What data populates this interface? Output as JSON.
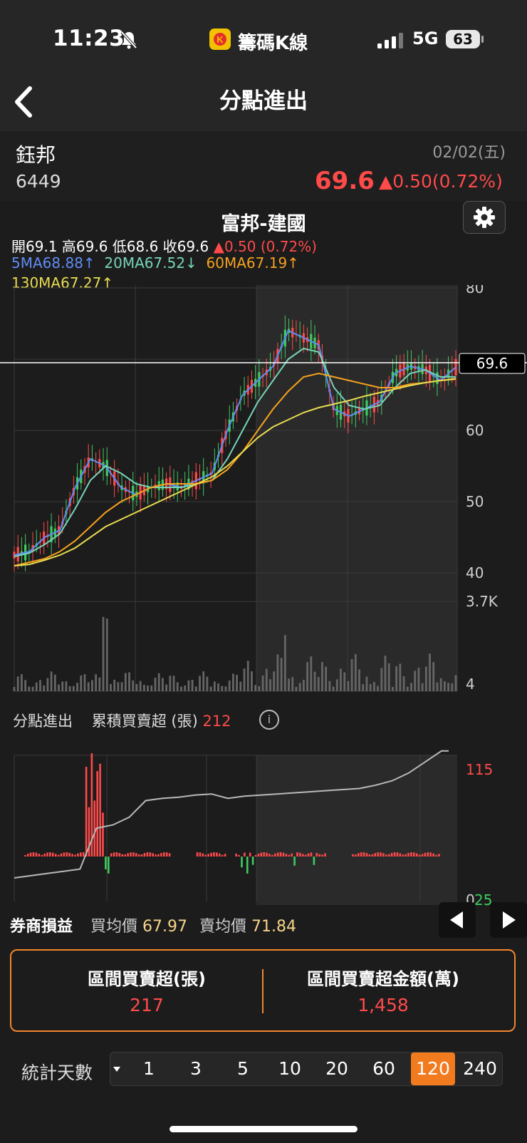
{
  "status": {
    "time": "11:23",
    "app_name": "籌碼K線",
    "network": "5G",
    "battery": "63"
  },
  "nav": {
    "title": "分點進出"
  },
  "stock": {
    "name": "鈺邦",
    "code": "6449",
    "date": "02/02(五)",
    "price": "69.6",
    "change": "▲0.50(0.72%)"
  },
  "broker": {
    "title": "富邦-建國"
  },
  "ohlc": {
    "open_label": "開",
    "open": "69.1",
    "high_label": "高",
    "high": "69.6",
    "low_label": "低",
    "low": "68.6",
    "close_label": "收",
    "close": "69.6",
    "change": "▲0.50 (0.72%)"
  },
  "ma": {
    "ma5": "5MA68.88↑",
    "ma20": "20MA67.52↓",
    "ma60": "60MA67.19↑",
    "ma130": "130MA67.27↑"
  },
  "price_axis": {
    "ticks": [
      "80",
      "60",
      "50",
      "40"
    ],
    "current": "69.6"
  },
  "volume_axis": {
    "max": "3.7K",
    "min": "4"
  },
  "flow": {
    "label": "分點進出",
    "cum_label": "累積買賣超 (張)",
    "cum_value": "212",
    "info": "i",
    "axis_max": "115",
    "axis_min_a": "0",
    "axis_min_b": "25"
  },
  "pnl": {
    "label": "券商損益",
    "buy_avg_label": "買均價",
    "buy_avg": "67.97",
    "sell_avg_label": "賣均價",
    "sell_avg": "71.84"
  },
  "summary": {
    "net_label": "區間買賣超(張)",
    "net_value": "217",
    "amount_label": "區間買賣超金額(萬)",
    "amount_value": "1,458"
  },
  "days": {
    "label": "統計天數",
    "options": [
      "1",
      "3",
      "5",
      "10",
      "20",
      "60",
      "120",
      "240"
    ],
    "selected": "120"
  },
  "colors": {
    "up": "#ff4a4a",
    "down": "#3ecb5f",
    "accent": "#f27b1f",
    "ma5": "#5f8cf5",
    "ma20": "#76d4b8",
    "ma60": "#f5a21e",
    "ma130": "#e8dc50"
  },
  "chart_data": [
    {
      "type": "line",
      "title": "富邦-建國",
      "ylim": [
        40,
        80
      ],
      "series": [
        {
          "name": "5MA",
          "values": [
            42.5,
            43,
            45,
            46,
            52,
            56,
            55,
            52,
            51,
            52,
            52.5,
            52,
            53,
            54,
            60,
            65,
            67,
            69,
            74,
            73,
            72,
            63,
            62,
            63,
            64,
            68,
            69,
            68.5,
            67,
            68.88
          ]
        },
        {
          "name": "20MA",
          "values": [
            42.3,
            42.8,
            44,
            45.5,
            49,
            53,
            55,
            54,
            52.5,
            52,
            52,
            52,
            52.5,
            53,
            56,
            60,
            64,
            67,
            70,
            71.5,
            71,
            66,
            63.5,
            63,
            63.5,
            66,
            68,
            68.5,
            67.5,
            67.52
          ]
        },
        {
          "name": "60MA",
          "values": [
            41,
            41.5,
            42,
            43,
            44.5,
            46.5,
            48.5,
            50,
            51,
            52,
            52.5,
            52.5,
            52.5,
            53,
            54.5,
            57,
            60,
            63,
            65.5,
            67.5,
            68,
            67.5,
            67,
            66.5,
            66,
            66,
            66.5,
            66.7,
            67,
            67.19
          ]
        },
        {
          "name": "130MA",
          "values": [
            41,
            41.2,
            41.8,
            42.5,
            43.5,
            45,
            46.5,
            47.5,
            48.5,
            49.5,
            50.5,
            51.5,
            52.5,
            53.5,
            55,
            57,
            59,
            60.5,
            61.5,
            62.5,
            63.2,
            63.7,
            64.2,
            64.8,
            65.3,
            65.8,
            66.3,
            66.7,
            67,
            67.27
          ]
        }
      ]
    },
    {
      "type": "line",
      "title": "累積買賣超 (張)",
      "ylim": [
        0,
        115
      ],
      "series": [
        {
          "name": "累積買賣超 (張)",
          "values": [
            0,
            2,
            4,
            6,
            8,
            45,
            48,
            55,
            70,
            72,
            73,
            75,
            76,
            72,
            74,
            75,
            76,
            77,
            78,
            79,
            80,
            81,
            84,
            88,
            95,
            105,
            115
          ]
        }
      ]
    }
  ]
}
